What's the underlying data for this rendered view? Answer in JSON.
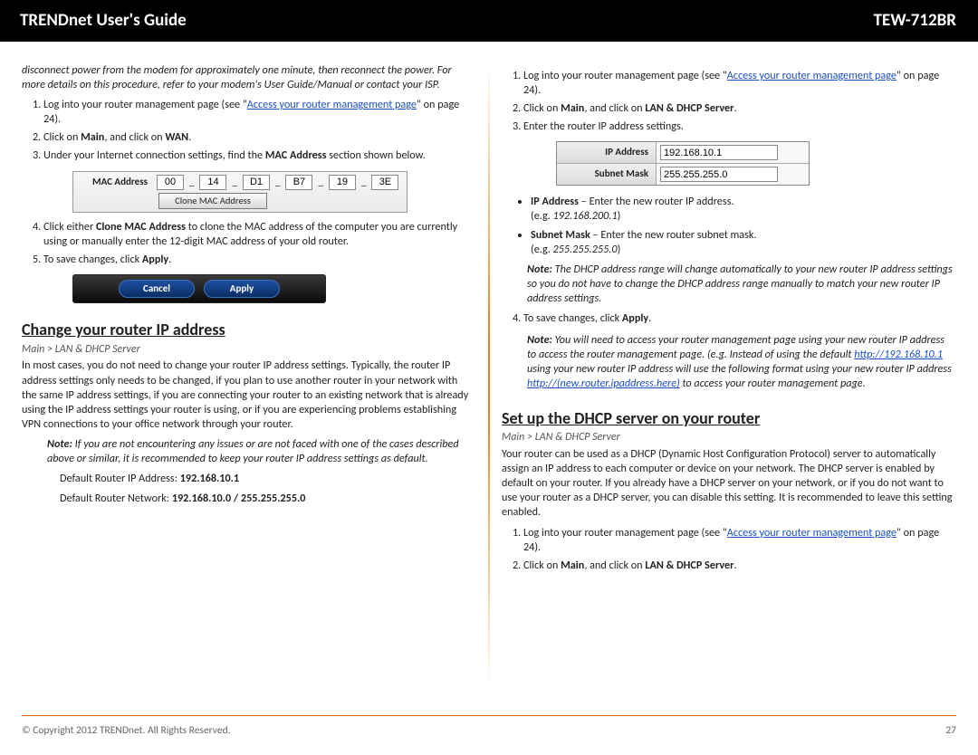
{
  "header": {
    "left": "TRENDnet User's Guide",
    "right": "TEW-712BR"
  },
  "left": {
    "intro": "disconnect power from the modem for approximately one minute, then reconnect the power. For more details on this procedure, refer to your modem's User Guide/Manual or contact your ISP.",
    "steps1": {
      "s1a": "Log into your router management page (see \"",
      "s1link": "Access your router management page",
      "s1b": "\" on page 24).",
      "s2a": "Click on ",
      "s2b": "Main",
      "s2c": ", and click on ",
      "s2d": "WAN",
      "s2e": ".",
      "s3a": "Under your Internet connection settings, find the ",
      "s3b": "MAC Address",
      "s3c": " section shown below."
    },
    "mac": {
      "label": "MAC Address",
      "segs": [
        "00",
        "14",
        "D1",
        "B7",
        "19",
        "3E"
      ],
      "clone": "Clone MAC Address"
    },
    "s4a": "Click either ",
    "s4b": "Clone MAC Address",
    "s4c": " to clone the MAC address of the computer you are currently using or manually enter the 12-digit MAC address of your old router.",
    "s5a": "To save changes, click ",
    "s5b": "Apply",
    "s5c": ".",
    "btns": {
      "cancel": "Cancel",
      "apply": "Apply"
    },
    "h2": "Change your router IP address",
    "crumb": "Main > LAN & DHCP Server",
    "para": "In most cases, you do not need to change your router IP address settings. Typically, the router IP address settings only needs to be changed, if you plan to use another router in your network with the same IP address settings, if you are connecting your router to an existing network that is already using the IP address settings your router is using, or if you are experiencing problems establishing VPN connections to your office network through your router.",
    "note": " If you are not encountering any issues or are not faced with one of the cases described above or similar, it is recommended to keep your router IP address settings as default.",
    "defA_pre": "Default Router IP Address: ",
    "defA_val": "192.168.10.1",
    "defB_pre": "Default Router Network: ",
    "defB_val": "192.168.10.0 / 255.255.255.0"
  },
  "right": {
    "steps1": {
      "s1a": "Log into your router management page (see \"",
      "s1link": "Access your router management page",
      "s1b": "\" on page 24).",
      "s2a": "Click on ",
      "s2b": "Main",
      "s2c": ", and click on ",
      "s2d": "LAN & DHCP Server",
      "s2e": ".",
      "s3": "Enter the router IP address settings."
    },
    "ip": {
      "ip_label": "IP Address",
      "ip_val": "192.168.10.1",
      "sm_label": "Subnet Mask",
      "sm_val": "255.255.255.0"
    },
    "bul": {
      "ip_a": "IP Address",
      "ip_b": " – Enter the new router IP address.",
      "ip_eg": "192.168.200.1",
      "sm_a": "Subnet Mask",
      "sm_b": " – Enter the new router subnet mask.",
      "sm_eg": "255.255.255.0"
    },
    "noteA": " The DHCP address range will change automatically to your new router IP address settings so you do not have to change the DHCP address range manually to match your new router IP address settings.",
    "s4a": "To save changes, click ",
    "s4b": "Apply",
    "s4c": ".",
    "noteB_a": " You will need to access your router management page using your new router IP address to access the router management page. (e.g. Instead of using the default ",
    "noteB_link1": "http://192.168.10.1",
    "noteB_b": " using your new router IP address will use the following format using your new router IP address ",
    "noteB_link2": "http://(new.router.ipaddress.here)",
    "noteB_c": " to access your router management page.",
    "h2": "Set up the DHCP server on your router",
    "crumb": "Main > LAN & DHCP Server",
    "para": "Your router can be used as a DHCP (Dynamic Host Configuration Protocol) server to automatically assign an IP address to each computer or device on your network. The DHCP server is enabled by default on your router. If you already have a DHCP server on your network, or if you do not want to use your router as a DHCP server, you can disable this setting. It is recommended to leave this setting enabled.",
    "steps2": {
      "s1a": "Log into your router management page (see \"",
      "s1link": "Access your router management page",
      "s1b": "\" on page 24).",
      "s2a": "Click on ",
      "s2b": "Main",
      "s2c": ", and click on ",
      "s2d": "LAN & DHCP Server",
      "s2e": "."
    }
  },
  "labels": {
    "note": "Note:",
    "eg": "(e.g. ",
    "egc": ")"
  },
  "footer": {
    "copy": "© Copyright 2012 TRENDnet. All Rights Reserved.",
    "page": "27"
  }
}
